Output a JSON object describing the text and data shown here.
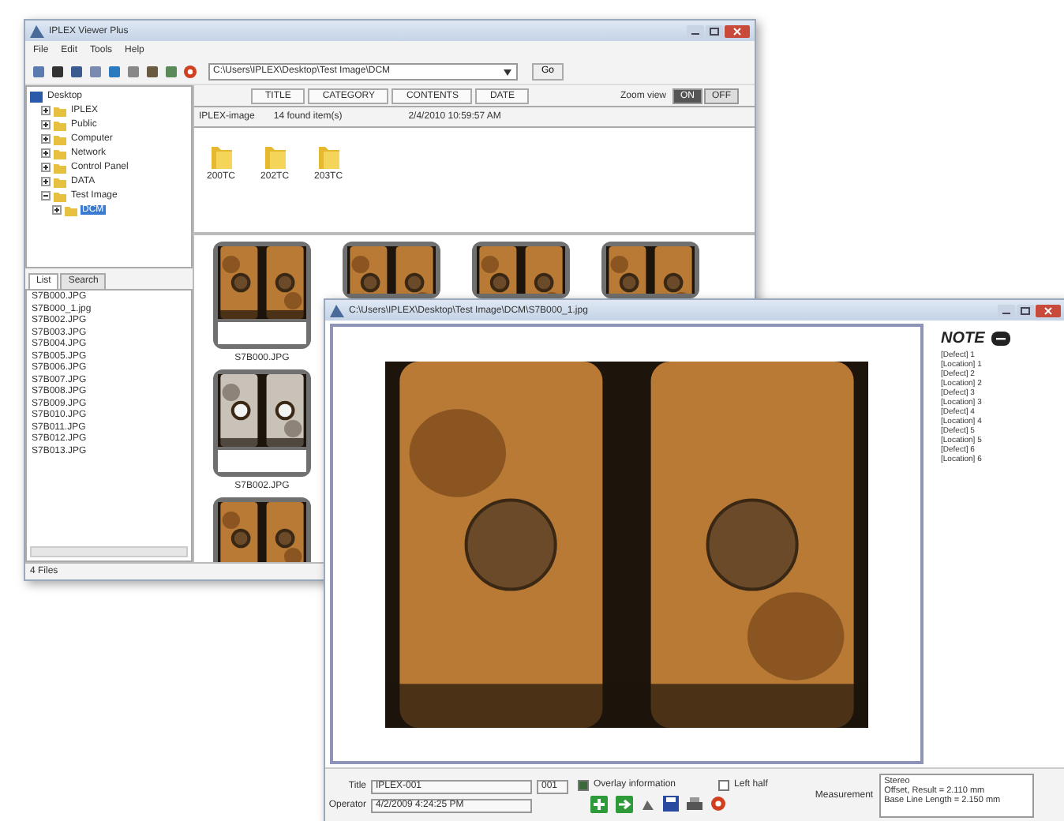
{
  "main_window": {
    "title": "IPLEX Viewer Plus",
    "menu": [
      "File",
      "Edit",
      "Tools",
      "Help"
    ],
    "address": "C:\\Users\\IPLEX\\Desktop\\Test Image\\DCM",
    "go_button": "Go",
    "tree": [
      {
        "label": "Desktop",
        "selected": false,
        "children": [
          {
            "label": "IPLEX",
            "expanded": false,
            "selected": false
          },
          {
            "label": "Public",
            "expanded": false,
            "selected": false
          },
          {
            "label": "Computer",
            "expanded": false,
            "selected": false
          },
          {
            "label": "Network",
            "expanded": false,
            "selected": false
          },
          {
            "label": "Control Panel",
            "expanded": false,
            "selected": false
          },
          {
            "label": "DATA",
            "expanded": false,
            "selected": false
          },
          {
            "label": "Test Image",
            "expanded": true,
            "selected": false,
            "children": [
              {
                "label": "DCM",
                "expanded": false,
                "selected": true
              }
            ]
          }
        ]
      }
    ],
    "list_tabs": [
      {
        "label": "List",
        "selected": true
      },
      {
        "label": "Search",
        "selected": false
      }
    ],
    "files": [
      "S7B000.JPG",
      "S7B000_1.jpg",
      "S7B002.JPG",
      "S7B003.JPG",
      "S7B004.JPG",
      "S7B005.JPG",
      "S7B006.JPG",
      "S7B007.JPG",
      "S7B008.JPG",
      "S7B009.JPG",
      "S7B010.JPG",
      "S7B011.JPG",
      "S7B012.JPG",
      "S7B013.JPG"
    ],
    "columns": [
      "TITLE",
      "CATEGORY",
      "CONTENTS",
      "DATE"
    ],
    "info": {
      "source": "IPLEX-image",
      "count": "14 found item(s)",
      "date": "2/4/2010 10:59:57 AM"
    },
    "view_toggle": {
      "label": "Zoom view",
      "options": [
        {
          "label": "ON",
          "selected": true
        },
        {
          "label": "OFF",
          "selected": false
        }
      ]
    },
    "folders": [
      "200TC",
      "202TC",
      "203TC"
    ],
    "thumbnail_rows": [
      [
        {
          "caption": "S7B000.JPG",
          "kind": "picture"
        },
        {
          "kind": "picture"
        },
        {
          "kind": "picture"
        },
        {
          "kind": "picture"
        }
      ],
      [
        {
          "caption": "S7B002.JPG",
          "kind": "picture"
        }
      ],
      [
        {
          "kind": "picture"
        }
      ]
    ],
    "status_bar": "4 Files"
  },
  "viewer_window": {
    "title": "C:\\Users\\IPLEX\\Desktop\\Test Image\\DCM\\S7B000_1.jpg",
    "note_label": "NOTE",
    "notes": [
      "[Defect] 1",
      "[Location] 1",
      "[Defect] 2",
      "[Location] 2",
      "[Defect] 3",
      "[Location] 3",
      "[Defect] 4",
      "[Location] 4",
      "[Defect] 5",
      "[Location] 5",
      "[Defect] 6",
      "[Location] 6"
    ],
    "title_label": "Title",
    "title_value": "IPLEX-001",
    "title_number": "001",
    "operator_label": "Operator",
    "operator_value": "4/2/2009 4:24:25 PM",
    "overlay": {
      "label": "Overlay information",
      "checked": true
    },
    "left_half": {
      "label": "Left half",
      "checked": false
    },
    "measurement_label": "Measurement",
    "measurement_lines": [
      "Stereo",
      "Offset, Result = 2.110 mm",
      "Base Line Length = 2.150 mm"
    ]
  }
}
